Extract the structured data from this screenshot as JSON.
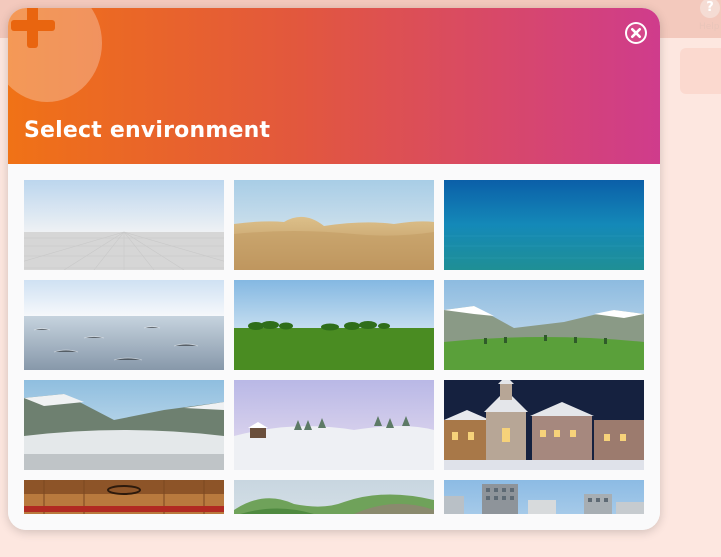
{
  "background": {
    "help_label": "Help",
    "help_icon": "question-mark-icon"
  },
  "modal": {
    "title": "Select environment",
    "add_icon": "plus-icon",
    "close_icon": "close-icon"
  },
  "environments": [
    {
      "id": "grid-floor",
      "icon": "grid-floor-thumbnail"
    },
    {
      "id": "desert",
      "icon": "desert-thumbnail"
    },
    {
      "id": "underwater",
      "icon": "underwater-thumbnail"
    },
    {
      "id": "ocean",
      "icon": "ocean-thumbnail"
    },
    {
      "id": "grass-plain",
      "icon": "grass-plain-thumbnail"
    },
    {
      "id": "mountain-valley",
      "icon": "mountain-valley-thumbnail"
    },
    {
      "id": "snowy-mountains",
      "icon": "snowy-mountains-thumbnail"
    },
    {
      "id": "snowy-cabin",
      "icon": "snowy-cabin-thumbnail"
    },
    {
      "id": "winter-village-night",
      "icon": "winter-village-thumbnail"
    },
    {
      "id": "wooden-interior",
      "icon": "wooden-interior-thumbnail"
    },
    {
      "id": "green-hills",
      "icon": "green-hills-thumbnail"
    },
    {
      "id": "city",
      "icon": "city-thumbnail"
    }
  ],
  "colors": {
    "header_gradient": [
      "#f07216",
      "#e2573e",
      "#cf3c8c"
    ],
    "page_background": "#fde7e0",
    "accent_orange": "#e9650f"
  }
}
